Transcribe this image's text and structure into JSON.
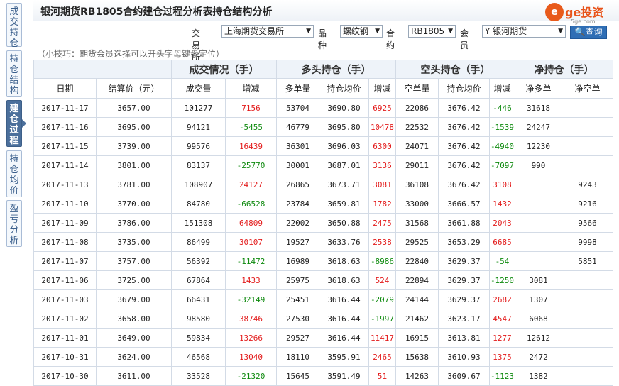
{
  "title": "银河期货RB1805合约建仓过程分析表持仓结构分析",
  "side_tabs": [
    {
      "label": "成交持仓",
      "active": false
    },
    {
      "label": "持仓结构",
      "active": false
    },
    {
      "label": "建仓过程",
      "active": true
    },
    {
      "label": "持仓均价",
      "active": false
    },
    {
      "label": "盈亏分析",
      "active": false
    }
  ],
  "logo": {
    "mark": "e",
    "text": "ge投资",
    "sub": "5ge.com"
  },
  "filters": {
    "exchange_label": "交易所",
    "exchange_value": "上海期货交易所",
    "variety_label": "品种",
    "variety_value": "螺纹钢",
    "contract_label": "合约",
    "contract_value": "RB1805",
    "member_label": "会员",
    "member_value": "Y 银河期货",
    "query_label": "查询"
  },
  "tip": "（小技巧：期货会员选择可以开头字母键盘定位）",
  "table": {
    "group_headers": [
      "成交情况（手）",
      "多头持仓（手）",
      "空头持仓（手）",
      "净持仓（手）"
    ],
    "columns": [
      "日期",
      "结算价（元）",
      "成交量",
      "增减",
      "多单量",
      "持仓均价",
      "增减",
      "空单量",
      "持仓均价",
      "增减",
      "净多单",
      "净空单"
    ],
    "rows": [
      [
        "2017-11-17",
        "3657.00",
        "101277",
        "7156",
        "53704",
        "3690.80",
        "6925",
        "22086",
        "3676.42",
        "-446",
        "31618",
        ""
      ],
      [
        "2017-11-16",
        "3695.00",
        "94121",
        "-5455",
        "46779",
        "3695.80",
        "10478",
        "22532",
        "3676.42",
        "-1539",
        "24247",
        ""
      ],
      [
        "2017-11-15",
        "3739.00",
        "99576",
        "16439",
        "36301",
        "3696.03",
        "6300",
        "24071",
        "3676.42",
        "-4940",
        "12230",
        ""
      ],
      [
        "2017-11-14",
        "3801.00",
        "83137",
        "-25770",
        "30001",
        "3687.01",
        "3136",
        "29011",
        "3676.42",
        "-7097",
        "990",
        ""
      ],
      [
        "2017-11-13",
        "3781.00",
        "108907",
        "24127",
        "26865",
        "3673.71",
        "3081",
        "36108",
        "3676.42",
        "3108",
        "",
        "9243"
      ],
      [
        "2017-11-10",
        "3770.00",
        "84780",
        "-66528",
        "23784",
        "3659.81",
        "1782",
        "33000",
        "3666.57",
        "1432",
        "",
        "9216"
      ],
      [
        "2017-11-09",
        "3786.00",
        "151308",
        "64809",
        "22002",
        "3650.88",
        "2475",
        "31568",
        "3661.88",
        "2043",
        "",
        "9566"
      ],
      [
        "2017-11-08",
        "3735.00",
        "86499",
        "30107",
        "19527",
        "3633.76",
        "2538",
        "29525",
        "3653.29",
        "6685",
        "",
        "9998"
      ],
      [
        "2017-11-07",
        "3757.00",
        "56392",
        "-11472",
        "16989",
        "3618.63",
        "-8986",
        "22840",
        "3629.37",
        "-54",
        "",
        "5851"
      ],
      [
        "2017-11-06",
        "3725.00",
        "67864",
        "1433",
        "25975",
        "3618.63",
        "524",
        "22894",
        "3629.37",
        "-1250",
        "3081",
        ""
      ],
      [
        "2017-11-03",
        "3679.00",
        "66431",
        "-32149",
        "25451",
        "3616.44",
        "-2079",
        "24144",
        "3629.37",
        "2682",
        "1307",
        ""
      ],
      [
        "2017-11-02",
        "3658.00",
        "98580",
        "38746",
        "27530",
        "3616.44",
        "-1997",
        "21462",
        "3623.17",
        "4547",
        "6068",
        ""
      ],
      [
        "2017-11-01",
        "3649.00",
        "59834",
        "13266",
        "29527",
        "3616.44",
        "11417",
        "16915",
        "3613.81",
        "1277",
        "12612",
        ""
      ],
      [
        "2017-10-31",
        "3624.00",
        "46568",
        "13040",
        "18110",
        "3595.91",
        "2465",
        "15638",
        "3610.93",
        "1375",
        "2472",
        ""
      ],
      [
        "2017-10-30",
        "3611.00",
        "33528",
        "-21320",
        "15645",
        "3591.49",
        "51",
        "14263",
        "3609.67",
        "-1123",
        "1382",
        ""
      ]
    ]
  },
  "colors": {
    "up": "#e31c1c",
    "down": "#0f8a0f",
    "accent": "#2f6eb5",
    "active_tab": "#4b6f9b"
  }
}
